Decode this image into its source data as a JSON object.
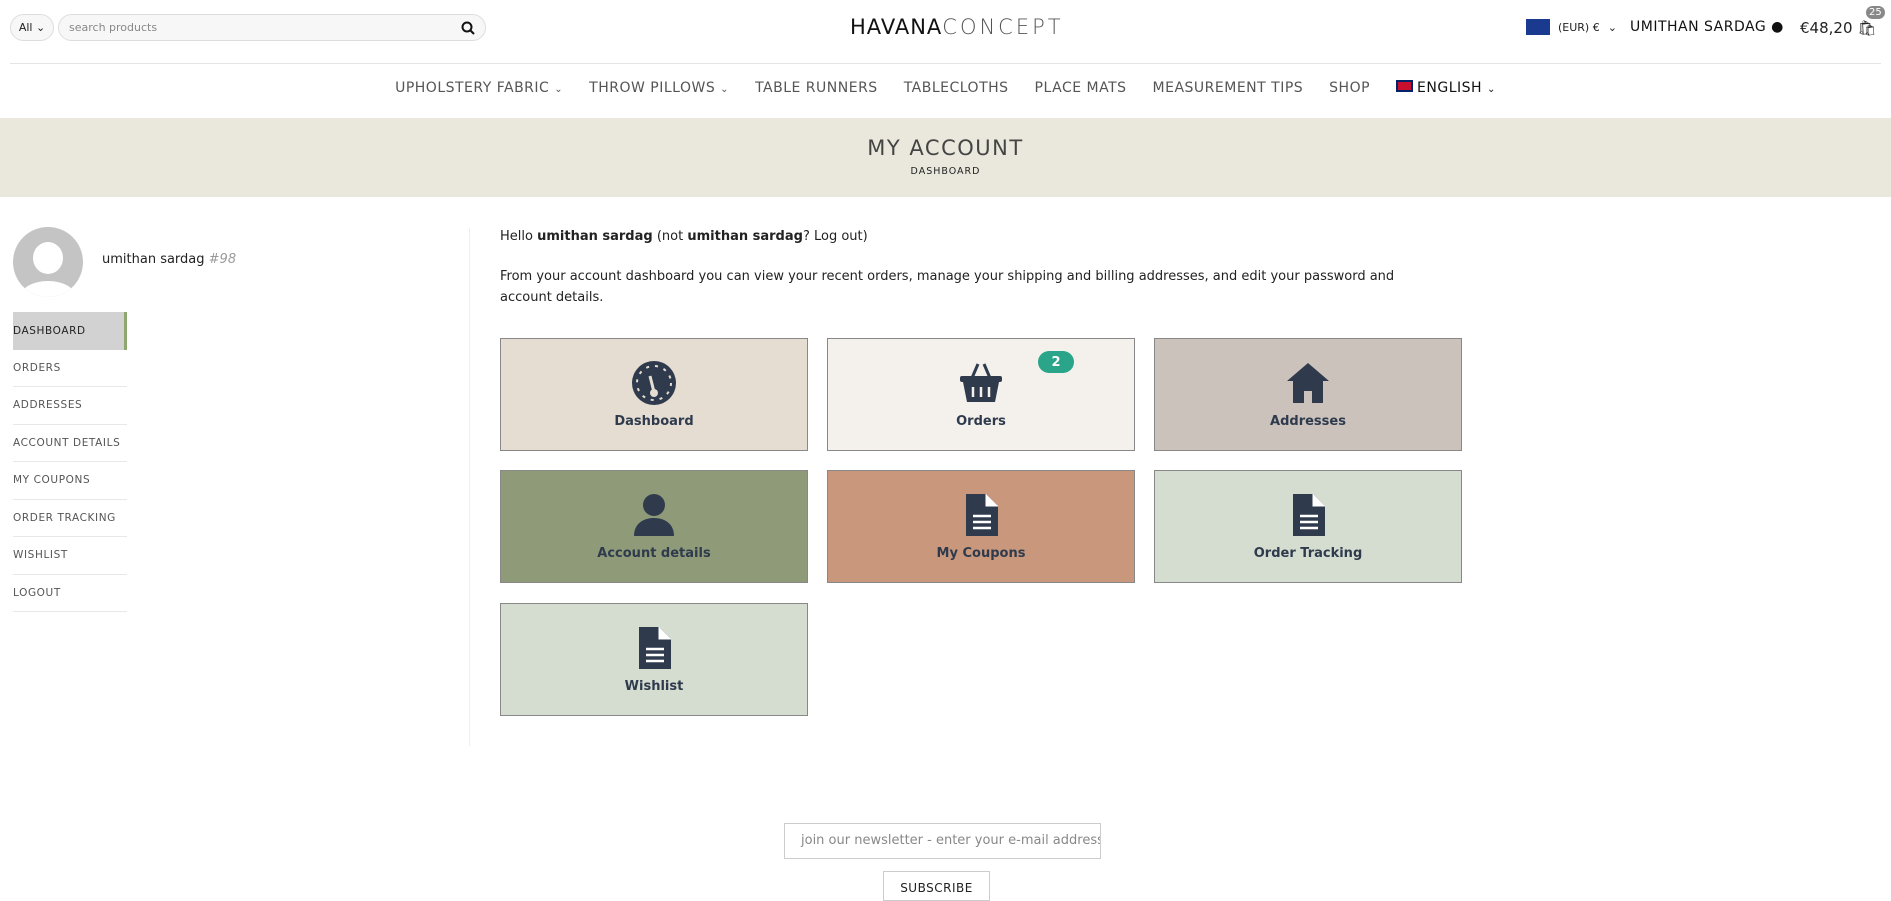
{
  "header": {
    "category_select": "All",
    "search_placeholder": "search products",
    "logo": "HAVANA CONCEPT",
    "logo_a": "HAVANA",
    "logo_b": "CONCEPT",
    "currency": "(EUR) €",
    "user": "UMITHAN SARDAG",
    "cart_total": "€48,20",
    "cart_count": "25"
  },
  "nav": [
    {
      "label": "UPHOLSTERY FABRIC",
      "dropdown": true
    },
    {
      "label": "THROW PILLOWS",
      "dropdown": true
    },
    {
      "label": "TABLE RUNNERS"
    },
    {
      "label": "TABLECLOTHS"
    },
    {
      "label": "PLACE MATS"
    },
    {
      "label": "MEASUREMENT TIPS"
    },
    {
      "label": "SHOP"
    },
    {
      "label": "ENGLISH",
      "dropdown": true
    }
  ],
  "banner": {
    "title": "MY ACCOUNT",
    "breadcrumb": "DASHBOARD"
  },
  "profile": {
    "name": "umithan sardag",
    "id": "#98"
  },
  "menu": [
    "DASHBOARD",
    "ORDERS",
    "ADDRESSES",
    "ACCOUNT DETAILS",
    "MY COUPONS",
    "ORDER TRACKING",
    "WISHLIST",
    "LOGOUT"
  ],
  "main": {
    "hello": "Hello",
    "name": "umithan sardag",
    "not": "(not",
    "name2": "umithan sardag",
    "logout": "? Log out)",
    "intro": "From your account dashboard you can view your recent orders, manage your shipping and billing addresses, and edit your password and account details."
  },
  "cards": [
    {
      "label": "Dashboard",
      "icon": "gauge-icon",
      "color": "#e5ddd2"
    },
    {
      "label": "Orders",
      "icon": "basket-icon",
      "color": "#f4f1ec",
      "badge": "2"
    },
    {
      "label": "Addresses",
      "icon": "home-icon",
      "color": "#cbc2bb"
    },
    {
      "label": "Account details",
      "icon": "user-icon",
      "color": "#8e9a78"
    },
    {
      "label": "My Coupons",
      "icon": "file-icon",
      "color": "#c8977c"
    },
    {
      "label": "Order Tracking",
      "icon": "file-icon",
      "color": "#d5dcd0"
    },
    {
      "label": "Wishlist",
      "icon": "file-icon",
      "color": "#d5dcd0"
    }
  ],
  "footer": {
    "newsletter_placeholder": "join our newsletter - enter your e-mail address",
    "subscribe": "SUBSCRIBE"
  }
}
